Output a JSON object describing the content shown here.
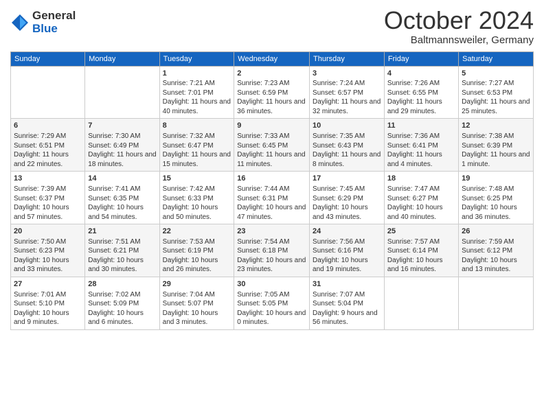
{
  "logo": {
    "general": "General",
    "blue": "Blue"
  },
  "title": "October 2024",
  "location": "Baltmannsweiler, Germany",
  "days_of_week": [
    "Sunday",
    "Monday",
    "Tuesday",
    "Wednesday",
    "Thursday",
    "Friday",
    "Saturday"
  ],
  "weeks": [
    [
      {
        "day": "",
        "sunrise": "",
        "sunset": "",
        "daylight": ""
      },
      {
        "day": "",
        "sunrise": "",
        "sunset": "",
        "daylight": ""
      },
      {
        "day": "1",
        "sunrise": "Sunrise: 7:21 AM",
        "sunset": "Sunset: 7:01 PM",
        "daylight": "Daylight: 11 hours and 40 minutes."
      },
      {
        "day": "2",
        "sunrise": "Sunrise: 7:23 AM",
        "sunset": "Sunset: 6:59 PM",
        "daylight": "Daylight: 11 hours and 36 minutes."
      },
      {
        "day": "3",
        "sunrise": "Sunrise: 7:24 AM",
        "sunset": "Sunset: 6:57 PM",
        "daylight": "Daylight: 11 hours and 32 minutes."
      },
      {
        "day": "4",
        "sunrise": "Sunrise: 7:26 AM",
        "sunset": "Sunset: 6:55 PM",
        "daylight": "Daylight: 11 hours and 29 minutes."
      },
      {
        "day": "5",
        "sunrise": "Sunrise: 7:27 AM",
        "sunset": "Sunset: 6:53 PM",
        "daylight": "Daylight: 11 hours and 25 minutes."
      }
    ],
    [
      {
        "day": "6",
        "sunrise": "Sunrise: 7:29 AM",
        "sunset": "Sunset: 6:51 PM",
        "daylight": "Daylight: 11 hours and 22 minutes."
      },
      {
        "day": "7",
        "sunrise": "Sunrise: 7:30 AM",
        "sunset": "Sunset: 6:49 PM",
        "daylight": "Daylight: 11 hours and 18 minutes."
      },
      {
        "day": "8",
        "sunrise": "Sunrise: 7:32 AM",
        "sunset": "Sunset: 6:47 PM",
        "daylight": "Daylight: 11 hours and 15 minutes."
      },
      {
        "day": "9",
        "sunrise": "Sunrise: 7:33 AM",
        "sunset": "Sunset: 6:45 PM",
        "daylight": "Daylight: 11 hours and 11 minutes."
      },
      {
        "day": "10",
        "sunrise": "Sunrise: 7:35 AM",
        "sunset": "Sunset: 6:43 PM",
        "daylight": "Daylight: 11 hours and 8 minutes."
      },
      {
        "day": "11",
        "sunrise": "Sunrise: 7:36 AM",
        "sunset": "Sunset: 6:41 PM",
        "daylight": "Daylight: 11 hours and 4 minutes."
      },
      {
        "day": "12",
        "sunrise": "Sunrise: 7:38 AM",
        "sunset": "Sunset: 6:39 PM",
        "daylight": "Daylight: 11 hours and 1 minute."
      }
    ],
    [
      {
        "day": "13",
        "sunrise": "Sunrise: 7:39 AM",
        "sunset": "Sunset: 6:37 PM",
        "daylight": "Daylight: 10 hours and 57 minutes."
      },
      {
        "day": "14",
        "sunrise": "Sunrise: 7:41 AM",
        "sunset": "Sunset: 6:35 PM",
        "daylight": "Daylight: 10 hours and 54 minutes."
      },
      {
        "day": "15",
        "sunrise": "Sunrise: 7:42 AM",
        "sunset": "Sunset: 6:33 PM",
        "daylight": "Daylight: 10 hours and 50 minutes."
      },
      {
        "day": "16",
        "sunrise": "Sunrise: 7:44 AM",
        "sunset": "Sunset: 6:31 PM",
        "daylight": "Daylight: 10 hours and 47 minutes."
      },
      {
        "day": "17",
        "sunrise": "Sunrise: 7:45 AM",
        "sunset": "Sunset: 6:29 PM",
        "daylight": "Daylight: 10 hours and 43 minutes."
      },
      {
        "day": "18",
        "sunrise": "Sunrise: 7:47 AM",
        "sunset": "Sunset: 6:27 PM",
        "daylight": "Daylight: 10 hours and 40 minutes."
      },
      {
        "day": "19",
        "sunrise": "Sunrise: 7:48 AM",
        "sunset": "Sunset: 6:25 PM",
        "daylight": "Daylight: 10 hours and 36 minutes."
      }
    ],
    [
      {
        "day": "20",
        "sunrise": "Sunrise: 7:50 AM",
        "sunset": "Sunset: 6:23 PM",
        "daylight": "Daylight: 10 hours and 33 minutes."
      },
      {
        "day": "21",
        "sunrise": "Sunrise: 7:51 AM",
        "sunset": "Sunset: 6:21 PM",
        "daylight": "Daylight: 10 hours and 30 minutes."
      },
      {
        "day": "22",
        "sunrise": "Sunrise: 7:53 AM",
        "sunset": "Sunset: 6:19 PM",
        "daylight": "Daylight: 10 hours and 26 minutes."
      },
      {
        "day": "23",
        "sunrise": "Sunrise: 7:54 AM",
        "sunset": "Sunset: 6:18 PM",
        "daylight": "Daylight: 10 hours and 23 minutes."
      },
      {
        "day": "24",
        "sunrise": "Sunrise: 7:56 AM",
        "sunset": "Sunset: 6:16 PM",
        "daylight": "Daylight: 10 hours and 19 minutes."
      },
      {
        "day": "25",
        "sunrise": "Sunrise: 7:57 AM",
        "sunset": "Sunset: 6:14 PM",
        "daylight": "Daylight: 10 hours and 16 minutes."
      },
      {
        "day": "26",
        "sunrise": "Sunrise: 7:59 AM",
        "sunset": "Sunset: 6:12 PM",
        "daylight": "Daylight: 10 hours and 13 minutes."
      }
    ],
    [
      {
        "day": "27",
        "sunrise": "Sunrise: 7:01 AM",
        "sunset": "Sunset: 5:10 PM",
        "daylight": "Daylight: 10 hours and 9 minutes."
      },
      {
        "day": "28",
        "sunrise": "Sunrise: 7:02 AM",
        "sunset": "Sunset: 5:09 PM",
        "daylight": "Daylight: 10 hours and 6 minutes."
      },
      {
        "day": "29",
        "sunrise": "Sunrise: 7:04 AM",
        "sunset": "Sunset: 5:07 PM",
        "daylight": "Daylight: 10 hours and 3 minutes."
      },
      {
        "day": "30",
        "sunrise": "Sunrise: 7:05 AM",
        "sunset": "Sunset: 5:05 PM",
        "daylight": "Daylight: 10 hours and 0 minutes."
      },
      {
        "day": "31",
        "sunrise": "Sunrise: 7:07 AM",
        "sunset": "Sunset: 5:04 PM",
        "daylight": "Daylight: 9 hours and 56 minutes."
      },
      {
        "day": "",
        "sunrise": "",
        "sunset": "",
        "daylight": ""
      },
      {
        "day": "",
        "sunrise": "",
        "sunset": "",
        "daylight": ""
      }
    ]
  ]
}
